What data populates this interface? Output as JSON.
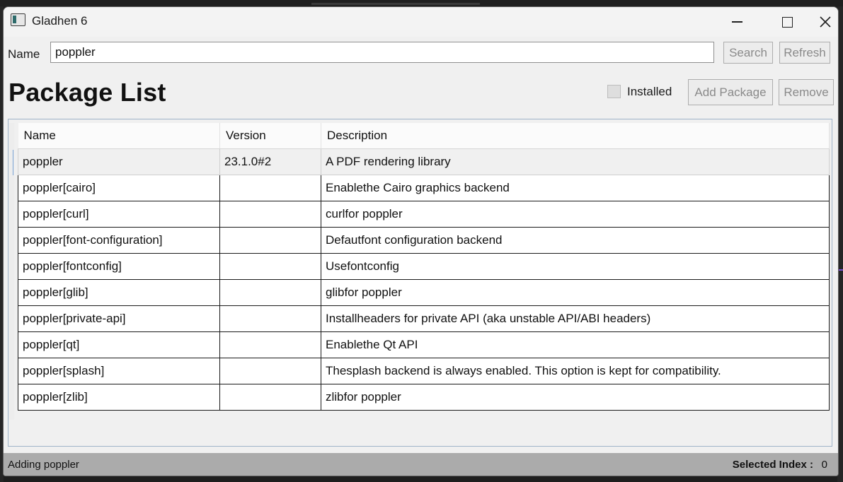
{
  "window": {
    "title": "Gladhen 6"
  },
  "search": {
    "label": "Name",
    "value": "poppler",
    "search_button": "Search",
    "refresh_button": "Refresh"
  },
  "page": {
    "heading": "Package List",
    "installed_label": "Installed",
    "installed_checked": false,
    "add_button": "Add Package",
    "remove_button": "Remove"
  },
  "table": {
    "columns": [
      "Name",
      "Version",
      "Description"
    ],
    "rows": [
      {
        "name": "poppler",
        "version": "23.1.0#2",
        "description": "A PDF rendering library"
      },
      {
        "name": "poppler[cairo]",
        "version": "",
        "description": "Enablethe Cairo graphics backend"
      },
      {
        "name": "poppler[curl]",
        "version": "",
        "description": "curlfor poppler"
      },
      {
        "name": "poppler[font-configuration]",
        "version": "",
        "description": "Defautfont configuration backend"
      },
      {
        "name": "poppler[fontconfig]",
        "version": "",
        "description": "Usefontconfig"
      },
      {
        "name": "poppler[glib]",
        "version": "",
        "description": "glibfor poppler"
      },
      {
        "name": "poppler[private-api]",
        "version": "",
        "description": "Installheaders for private API (aka unstable API/ABI headers)"
      },
      {
        "name": "poppler[qt]",
        "version": "",
        "description": "Enablethe Qt API"
      },
      {
        "name": "poppler[splash]",
        "version": "",
        "description": "Thesplash backend is always enabled. This option is kept for compatibility."
      },
      {
        "name": "poppler[zlib]",
        "version": "",
        "description": "zlibfor poppler"
      }
    ]
  },
  "status": {
    "message": "Adding poppler",
    "selected_label": "Selected Index :",
    "selected_value": "0"
  },
  "icons": {
    "app": "app-window-icon",
    "minimize": "minimize-icon",
    "maximize": "maximize-icon",
    "close": "close-icon"
  }
}
